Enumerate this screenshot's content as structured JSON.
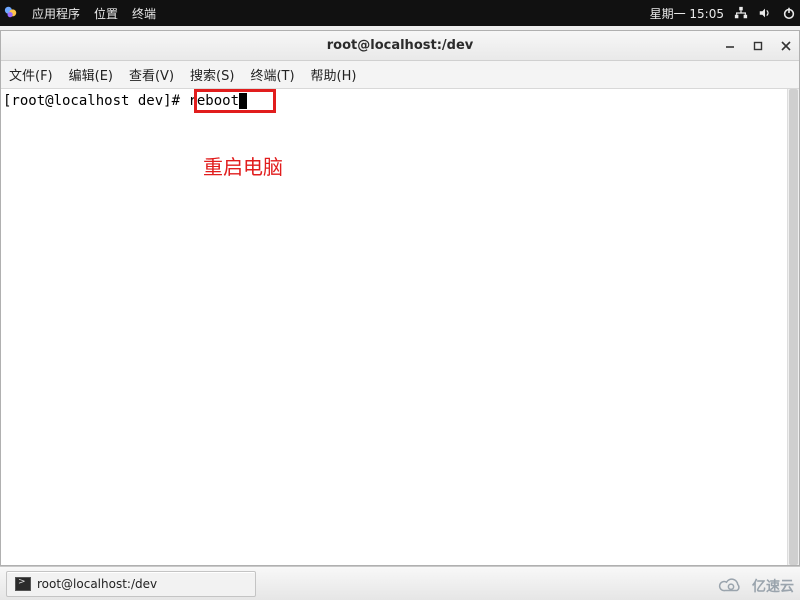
{
  "top_panel": {
    "apps": "应用程序",
    "places": "位置",
    "terminal": "终端",
    "clock": "星期一 15:05"
  },
  "window": {
    "title": "root@localhost:/dev",
    "menus": {
      "file": "文件(F)",
      "edit": "编辑(E)",
      "view": "查看(V)",
      "search": "搜索(S)",
      "terminal": "终端(T)",
      "help": "帮助(H)"
    },
    "prompt": "[root@localhost dev]# ",
    "command": "reboot",
    "annotation": "重启电脑"
  },
  "taskbar": {
    "task1": "root@localhost:/dev"
  },
  "watermark": {
    "text": "亿速云"
  },
  "colors": {
    "highlight": "#e11d1d"
  }
}
